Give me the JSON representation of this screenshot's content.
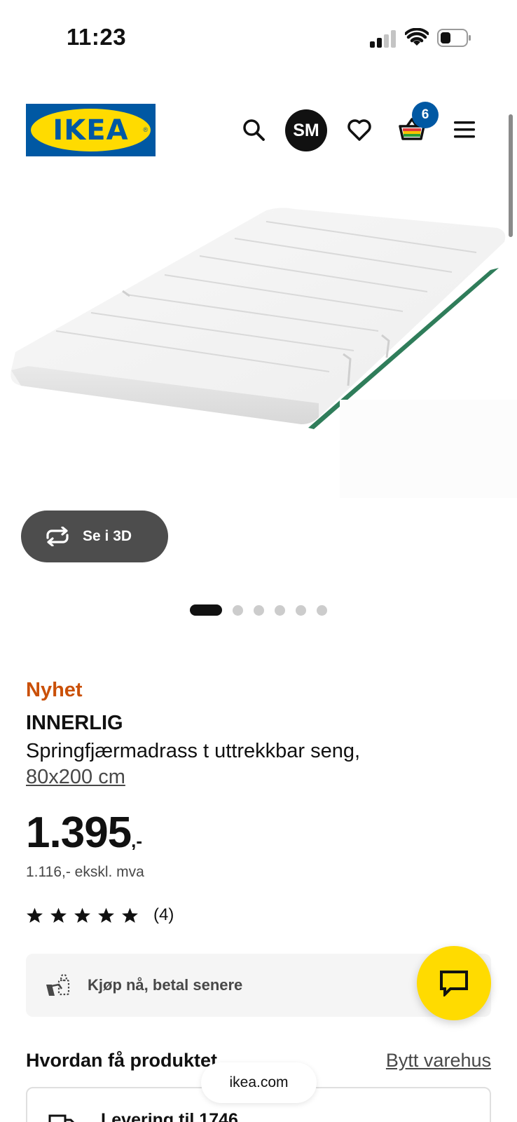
{
  "status_bar": {
    "time": "11:23",
    "signal_icon": "cellular-signal-icon",
    "wifi_icon": "wifi-icon",
    "battery_icon": "battery-low-icon"
  },
  "header": {
    "logo_text": "IKEA",
    "logo_reg": "®",
    "avatar_initials": "SM",
    "cart_count": "6",
    "icons": [
      "search-icon",
      "heart-icon",
      "shopping-bag-icon",
      "hamburger-menu-icon"
    ],
    "brand_colors": {
      "blue": "#0058a3",
      "yellow": "#ffdb00"
    }
  },
  "gallery": {
    "view_3d_label": "Se i 3D",
    "image_count": 6,
    "active_index": 0
  },
  "product": {
    "tag": "Nyhet",
    "tag_color": "#ca5008",
    "name": "INNERLIG",
    "description": "Springfjærmadrass t uttrekkbar seng,",
    "size": "80x200 cm",
    "price_main": "1.395",
    "price_suffix": ",-",
    "price_ex_vat": "1.116,- ekskl. mva",
    "rating_stars": 5,
    "rating_count": "(4)"
  },
  "pay_later": {
    "label": "Kjøp nå, betal senere"
  },
  "availability": {
    "title": "Hvordan få produktet",
    "change_store": "Bytt varehus",
    "delivery_label": "Levering til 1746"
  },
  "browser": {
    "url": "ikea.com"
  }
}
